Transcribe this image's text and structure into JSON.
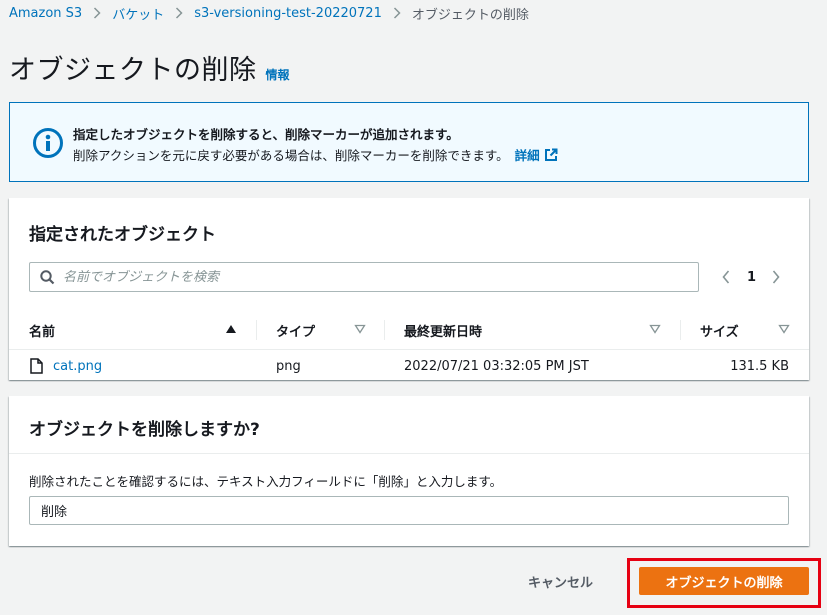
{
  "breadcrumb": {
    "items": [
      "Amazon S3",
      "バケット",
      "s3-versioning-test-20220721"
    ],
    "current": "オブジェクトの削除"
  },
  "page": {
    "title": "オブジェクトの削除",
    "info_link": "情報"
  },
  "alert": {
    "line1": "指定したオブジェクトを削除すると、削除マーカーが追加されます。",
    "line2": "削除アクションを元に戻す必要がある場合は、削除マーカーを削除できます。",
    "link": "詳細"
  },
  "objects_panel": {
    "heading": "指定されたオブジェクト",
    "search": {
      "placeholder": "名前でオブジェクトを検索",
      "value": ""
    },
    "pagination": {
      "current_page": "1"
    },
    "columns": [
      "名前",
      "タイプ",
      "最終更新日時",
      "サイズ"
    ],
    "rows": [
      {
        "name": "cat.png",
        "type": "png",
        "last_modified": "2022/07/21 03:32:05 PM JST",
        "size": "131.5 KB"
      }
    ]
  },
  "confirm_panel": {
    "heading": "オブジェクトを削除しますか?",
    "description": "削除されたことを確認するには、テキスト入力フィールドに「削除」と入力します。",
    "input_value": "削除"
  },
  "actions": {
    "cancel_label": "キャンセル",
    "delete_label": "オブジェクトの削除"
  },
  "colors": {
    "link": "#0073bb",
    "primary_button": "#ec7211",
    "alert_background": "#f1faff",
    "highlight_border": "#e60012"
  },
  "icons": [
    "chevron-right-icon",
    "info-icon",
    "external-link-icon",
    "search-icon",
    "chevron-left-icon",
    "sort-ascending-icon",
    "sort-descending-icon",
    "file-icon"
  ]
}
